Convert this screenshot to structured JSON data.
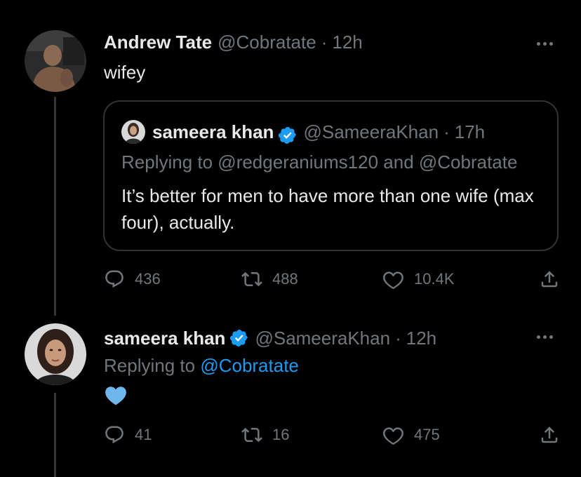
{
  "tweet1": {
    "display_name": "Andrew Tate",
    "handle": "@Cobratate",
    "separator": "·",
    "time": "12h",
    "text": "wifey",
    "quote": {
      "display_name": "sameera khan",
      "handle": "@SameeraKhan",
      "separator": "·",
      "time": "17h",
      "replying_to": "Replying to @redgeraniums120 and @Cobratate",
      "text": "It’s better for men to have more than one wife (max four), actually."
    },
    "stats": {
      "replies": "436",
      "retweets": "488",
      "likes": "10.4K"
    }
  },
  "tweet2": {
    "display_name": "sameera khan",
    "handle": "@SameeraKhan",
    "separator": "·",
    "time": "12h",
    "replying_prefix": "Replying to",
    "replying_handle": "@Cobratate",
    "text_emoji": "blue-heart",
    "stats": {
      "replies": "41",
      "retweets": "16",
      "likes": "475"
    }
  },
  "colors": {
    "background": "#000000",
    "text_primary": "#e7e9ea",
    "text_secondary": "#71767b",
    "accent": "#1d9bf0",
    "border": "#2f3336",
    "heart_emoji": "#6fb6ea"
  }
}
